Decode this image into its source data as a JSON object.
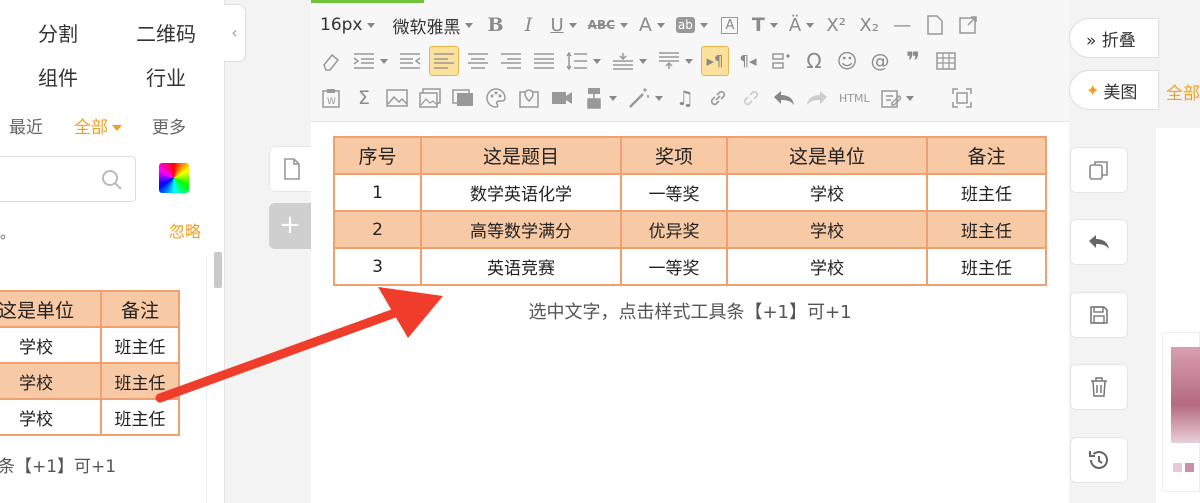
{
  "left_panel": {
    "categories": [
      "分割",
      "二维码",
      "组件",
      "行业"
    ],
    "tabs": [
      "最近",
      "全部",
      "更多"
    ],
    "tip": "。",
    "ignore": "忽略",
    "mini_table": {
      "header": [
        "这是单位",
        "备注"
      ],
      "rows": [
        [
          "学校",
          "班主任"
        ],
        [
          "学校",
          "班主任"
        ],
        [
          "学校",
          "班主任"
        ]
      ]
    },
    "caption": "条【+1】可+1"
  },
  "toolbar": {
    "font_size": "16px",
    "font_family": "微软雅黑",
    "html_label": "HTML"
  },
  "table": {
    "header": [
      "序号",
      "这是题目",
      "奖项",
      "这是单位",
      "备注"
    ],
    "rows": [
      [
        "1",
        "数学英语化学",
        "一等奖",
        "学校",
        "班主任"
      ],
      [
        "2",
        "高等数学满分",
        "优异奖",
        "学校",
        "班主任"
      ],
      [
        "3",
        "英语竞赛",
        "一等奖",
        "学校",
        "班主任"
      ]
    ]
  },
  "caption": "选中文字，点击样式工具条【+1】可+1",
  "right_panel": {
    "fold_label": "» 折叠",
    "meitu_label": "美图",
    "all_label": "全部"
  },
  "colors": {
    "accent": "#f0a020",
    "table_border": "#f0a070",
    "table_fill": "#f7c9a4",
    "arrow": "#f03c2a"
  }
}
